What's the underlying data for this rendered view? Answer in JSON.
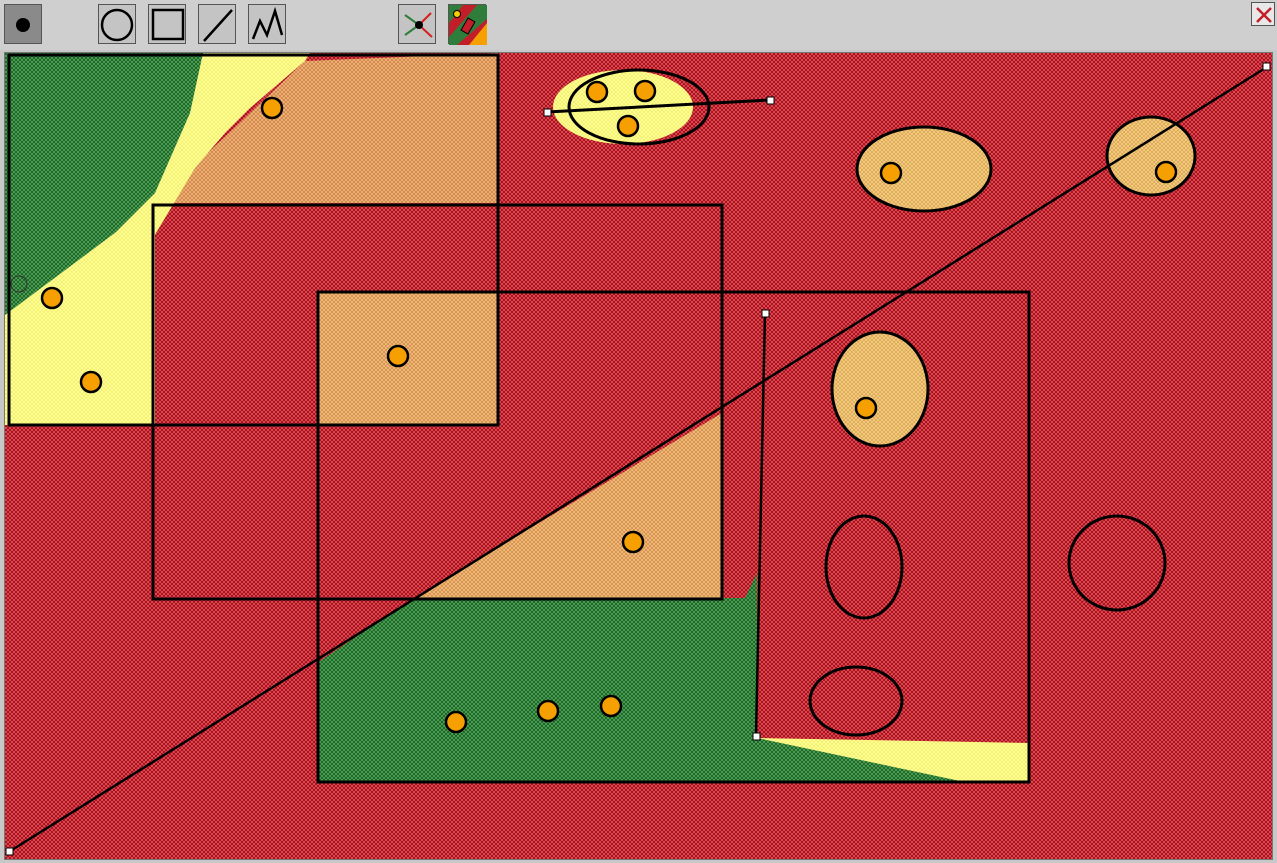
{
  "window": {
    "title": ""
  },
  "toolbar": {
    "tools": [
      {
        "name": "point-tool",
        "icon": "filled-dot-icon",
        "selected": true
      },
      {
        "name": "circle-tool",
        "icon": "circle-outline-icon",
        "selected": false
      },
      {
        "name": "rectangle-tool",
        "icon": "rectangle-outline-icon",
        "selected": false
      },
      {
        "name": "line-tool",
        "icon": "diagonal-line-icon",
        "selected": false
      },
      {
        "name": "polyline-tool",
        "icon": "zigzag-line-icon",
        "selected": false
      },
      {
        "name": "classify-tool",
        "icon": "classifier-icon",
        "selected": false
      },
      {
        "name": "color-map-tool",
        "icon": "decision-map-icon",
        "selected": false
      }
    ],
    "close": {
      "icon": "close-x-icon"
    }
  },
  "colors": {
    "red_region": "#c21e2a",
    "green_region": "#2f7d3b",
    "yellow_region": "#ffff90",
    "point_fill": "#f5a000",
    "outline": "#000000",
    "toolbar_bg": "#cfcfcf"
  }
}
